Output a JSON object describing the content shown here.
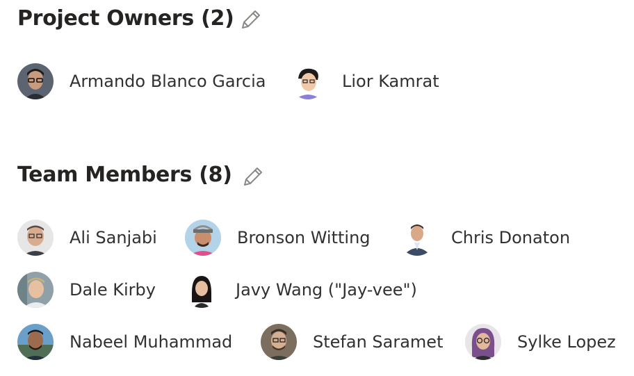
{
  "owners": {
    "title": "Project Owners (2)",
    "people": [
      {
        "name": "Armando Blanco Garcia"
      },
      {
        "name": "Lior Kamrat"
      }
    ]
  },
  "members": {
    "title": "Team Members (8)",
    "people": [
      {
        "name": "Ali Sanjabi"
      },
      {
        "name": "Bronson Witting"
      },
      {
        "name": "Chris Donaton"
      },
      {
        "name": "Dale Kirby"
      },
      {
        "name": "Javy Wang (\"Jay-vee\")"
      },
      {
        "name": "Nabeel Muhammad"
      },
      {
        "name": "Stefan Saramet"
      },
      {
        "name": "Sylke Lopez"
      }
    ]
  },
  "icons": {
    "edit": "pencil-icon",
    "avatar": "avatar-photo"
  },
  "colors": {
    "heading": "#252423",
    "text": "#323130",
    "icon": "#8a8886"
  }
}
